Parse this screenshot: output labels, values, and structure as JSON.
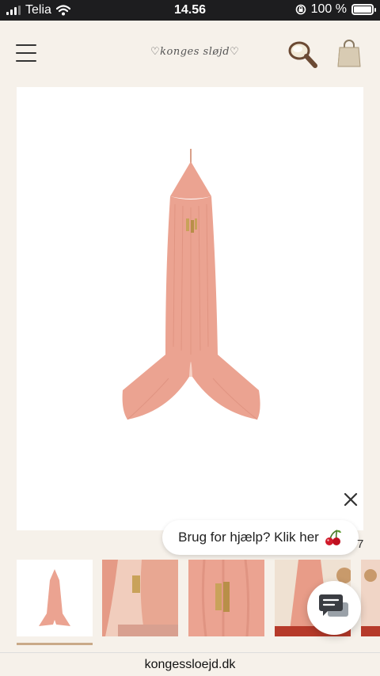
{
  "status_bar": {
    "carrier": "Telia",
    "time": "14.56",
    "battery": "100 %",
    "battery_level": 1.0
  },
  "header": {
    "logo_text": "konges sløjd"
  },
  "chat": {
    "help_text": "Brug for hjælp? Klik her",
    "count_suffix": "7"
  },
  "gallery": {
    "selected_index": 0,
    "thumbnail_count": 5
  },
  "browser": {
    "url": "kongessloejd.dk"
  },
  "colors": {
    "background": "#f6f1ea",
    "canopy": "#eba391",
    "tassel": "#c9a25a",
    "underline": "#c9a988"
  }
}
